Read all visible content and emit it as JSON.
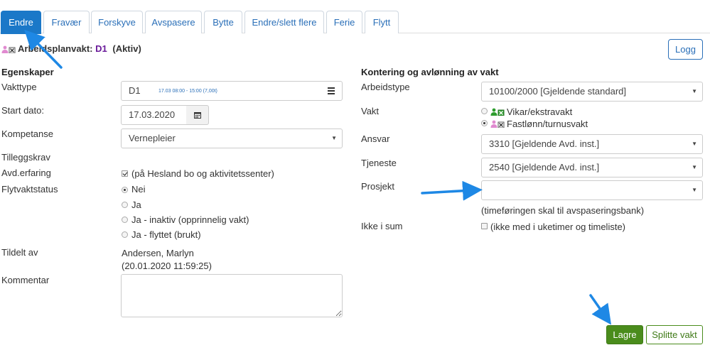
{
  "tabs": [
    {
      "label": "Endre",
      "active": true
    },
    {
      "label": "Fravær"
    },
    {
      "label": "Forskyve"
    },
    {
      "label": "Avspasere"
    },
    {
      "label": "Bytte"
    },
    {
      "label": "Endre/slett flere"
    },
    {
      "label": "Ferie"
    },
    {
      "label": "Flytt"
    }
  ],
  "header": {
    "title_prefix": "Arbeidsplanvakt:",
    "code": "D1",
    "status": "(Aktiv)",
    "logg_label": "Logg"
  },
  "left": {
    "section_title": "Egenskaper",
    "vakttype_label": "Vakttype",
    "vakttype_value": "D1",
    "vakttype_time": "17.03 08:00 - 15:00 (7,00t)",
    "startdato_label": "Start dato:",
    "startdato_value": "17.03.2020",
    "kompetanse_label": "Kompetanse",
    "kompetanse_value": "Vernepleier",
    "tilleggskrav_label": "Tilleggskrav",
    "avd_label": "Avd.erfaring",
    "avd_value": "(på Hesland bo og aktivitetssenter)",
    "flyt_label": "Flytvaktstatus",
    "flyt_options": [
      "Nei",
      "Ja",
      "Ja - inaktiv (opprinnelig vakt)",
      "Ja - flyttet (brukt)"
    ],
    "tildelt_label": "Tildelt av",
    "tildelt_name": "Andersen, Marlyn",
    "tildelt_date": "(20.01.2020 11:59:25)",
    "kommentar_label": "Kommentar"
  },
  "right": {
    "section_title": "Kontering og avlønning av vakt",
    "arbeidstype_label": "Arbeidstype",
    "arbeidstype_value": "10100/2000 [Gjeldende standard]",
    "vakt_label": "Vakt",
    "vakt_options": [
      "Vikar/ekstravakt",
      "Fastlønn/turnusvakt"
    ],
    "ansvar_label": "Ansvar",
    "ansvar_value": "3310 [Gjeldende Avd. inst.]",
    "tjeneste_label": "Tjeneste",
    "tjeneste_value": "2540 [Gjeldende Avd. inst.]",
    "prosjekt_label": "Prosjekt",
    "prosjekt_value": "",
    "prosjekt_note": "(timeføringen skal til avspaseringsbank)",
    "ikke_label": "Ikke i sum",
    "ikke_value": "(ikke med i uketimer og timeliste)"
  },
  "footer": {
    "lagre_label": "Lagre",
    "splitte_label": "Splitte vakt"
  },
  "colors": {
    "tab_active": "#1b78c8",
    "link_blue": "#2a6fb8",
    "save_green": "#4a8c1c",
    "annotation_arrow": "#1e88e5"
  }
}
